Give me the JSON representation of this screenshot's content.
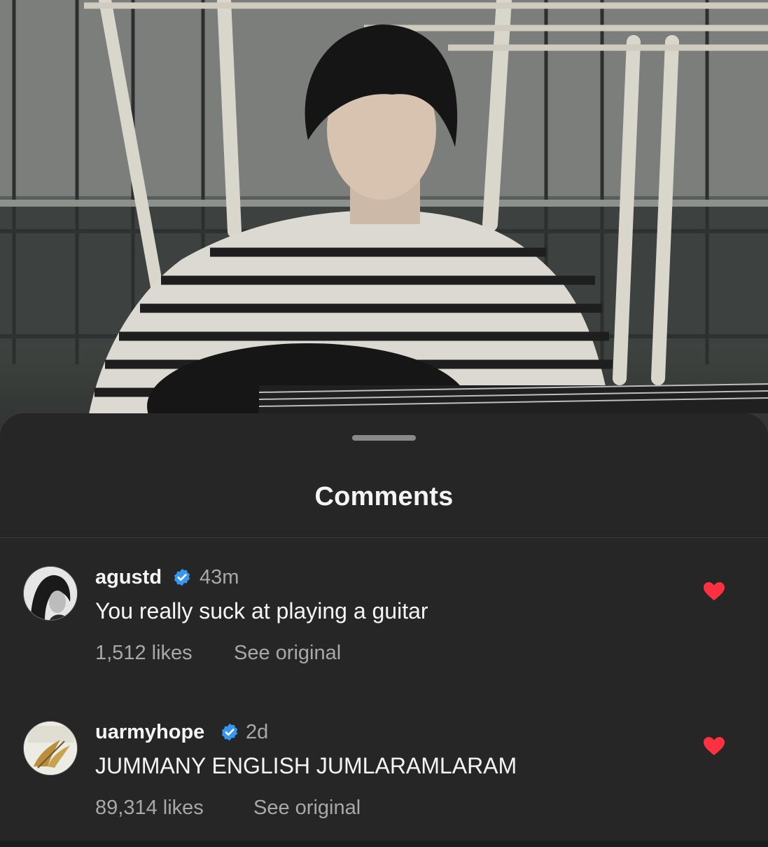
{
  "sheet": {
    "title": "Comments"
  },
  "comments": [
    {
      "username": "agustd",
      "verified": true,
      "time": "43m",
      "text": "You really suck at playing a guitar",
      "likes": "1,512 likes",
      "see_original": "See original",
      "liked": true
    },
    {
      "username": "uarmyhope",
      "verified": true,
      "time": "2d",
      "text": "JUMMANY ENGLISH JUMLARAMLARAM",
      "likes": "89,314 likes",
      "see_original": "See original",
      "liked": true
    }
  ],
  "colors": {
    "sheet_background": "#262626",
    "verified_badge": "#3797f0",
    "heart": "#ff3040",
    "secondary_text": "#a8a8a8"
  },
  "icons": [
    "verified-badge-icon",
    "heart-icon"
  ]
}
